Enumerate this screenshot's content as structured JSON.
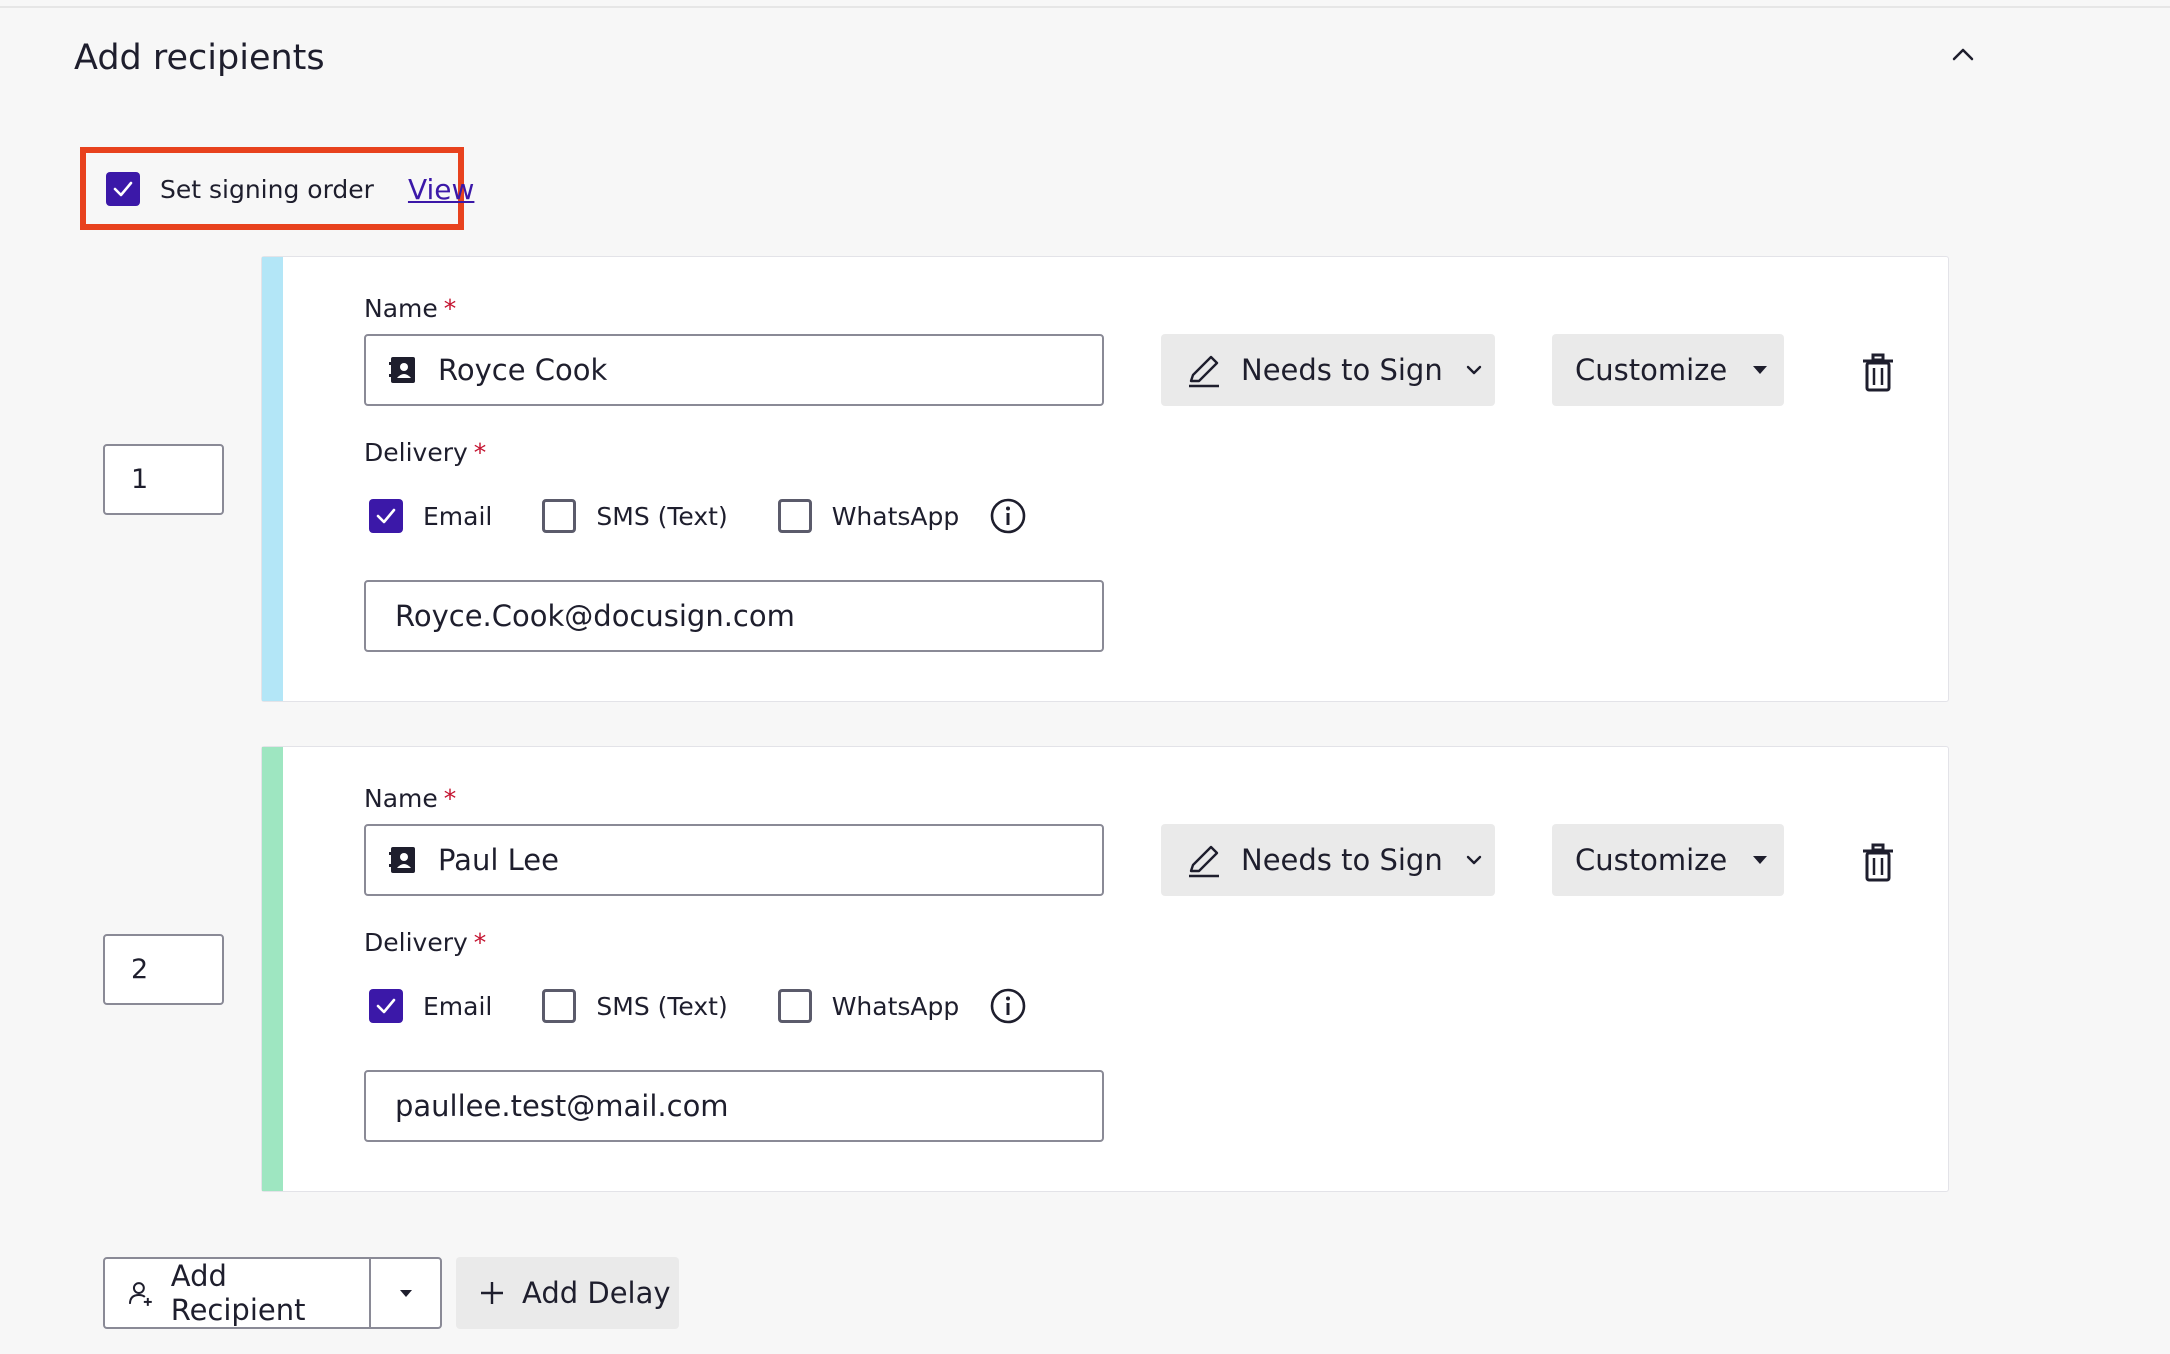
{
  "section": {
    "title": "Add recipients"
  },
  "signing_order": {
    "label": "Set signing order",
    "link": "View",
    "checked": true
  },
  "recipients": [
    {
      "order": "1",
      "accent_color": "#b3e6f7",
      "name_label": "Name",
      "name_value": "Royce Cook",
      "role": "Needs to Sign",
      "customize": "Customize",
      "delivery_label": "Delivery",
      "delivery_options": [
        "Email",
        "SMS (Text)",
        "WhatsApp"
      ],
      "email_value": "Royce.Cook@docusign.com"
    },
    {
      "order": "2",
      "accent_color": "#9ee6c1",
      "name_label": "Name",
      "name_value": "Paul Lee",
      "role": "Needs to Sign",
      "customize": "Customize",
      "delivery_label": "Delivery",
      "delivery_options": [
        "Email",
        "SMS (Text)",
        "WhatsApp"
      ],
      "email_value": "paullee.test@mail.com"
    }
  ],
  "required_mark": "*",
  "actions": {
    "add_recipient": "Add Recipient",
    "add_delay": "Add Delay"
  },
  "colors": {
    "accent": "#3b18a8",
    "highlight": "#e8421e",
    "required": "#c4122f"
  }
}
